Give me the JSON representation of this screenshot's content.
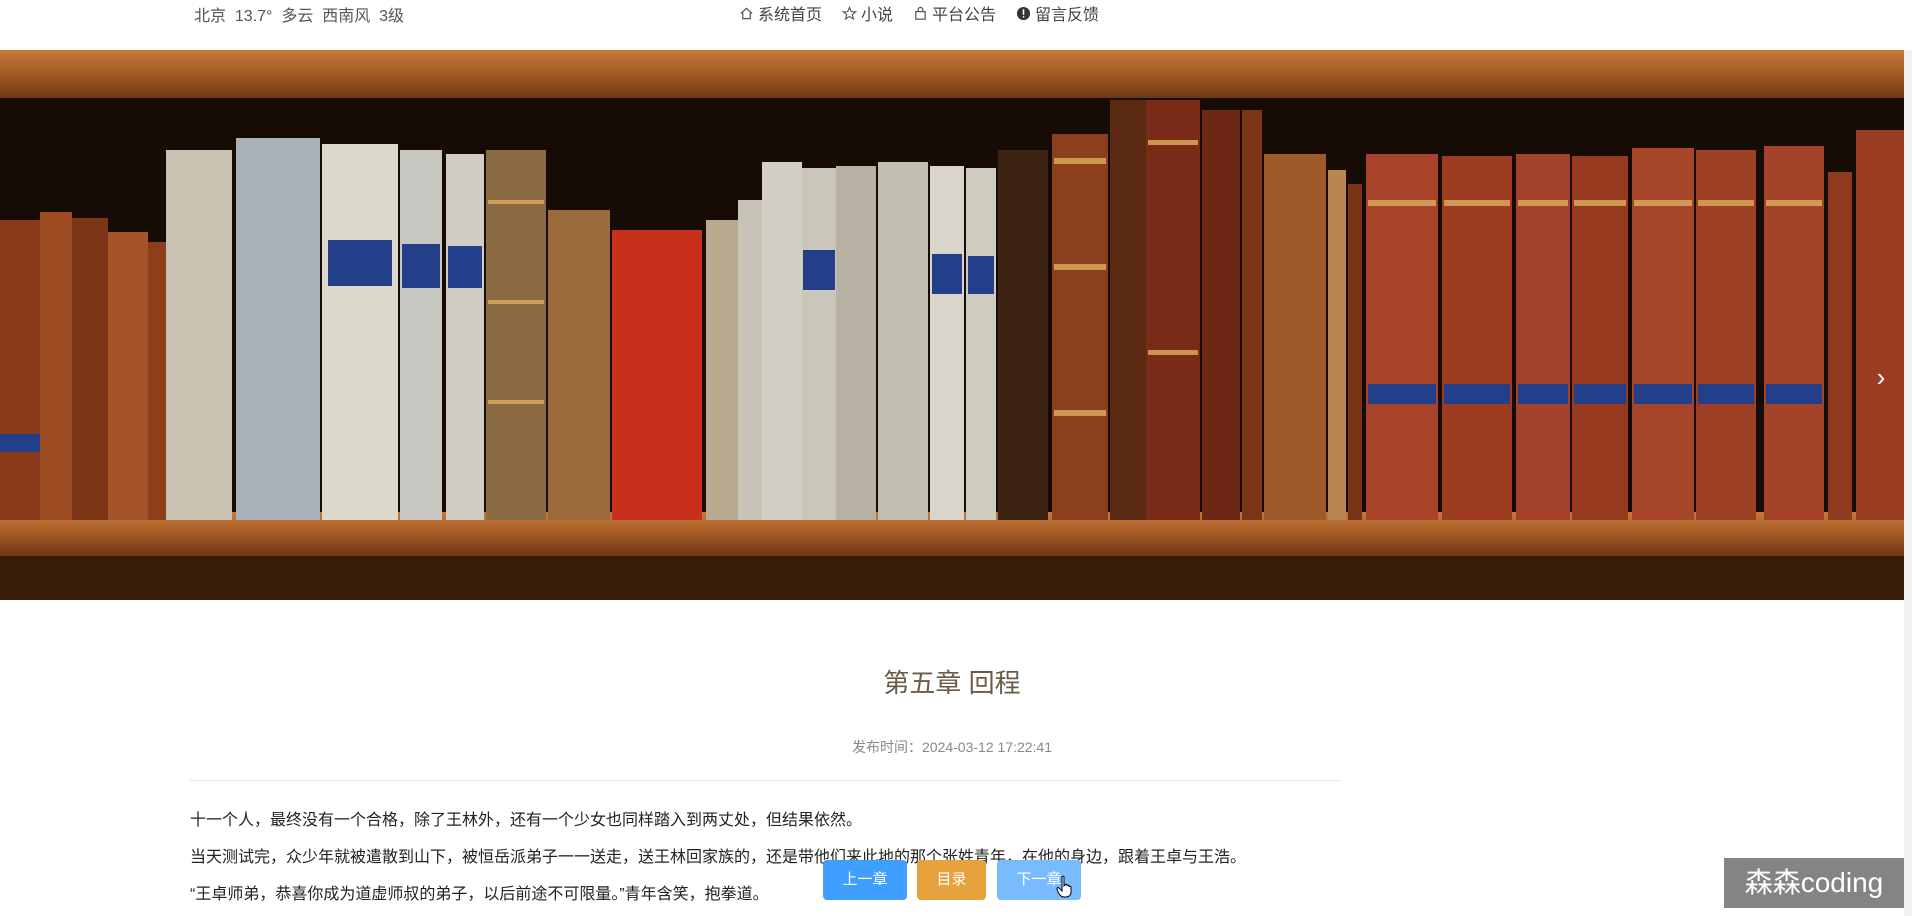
{
  "weather": "北京  13.7°  多云  西南风  3级",
  "nav": {
    "home": "系统首页",
    "novel": "小说",
    "notice": "平台公告",
    "feedback": "留言反馈"
  },
  "chapter": {
    "title": "第五章 回程",
    "publish_time": "发布时间：2024-03-12 17:22:41",
    "paragraphs": [
      "十一个人，最终没有一个合格，除了王林外，还有一个少女也同样踏入到两丈处，但结果依然。",
      "当天测试完，众少年就被遣散到山下，被恒岳派弟子一一送走，送王林回家族的，还是带他们来此地的那个张姓青年，在他的身边，跟着王卓与王浩。",
      "“王卓师弟，恭喜你成为道虚师叔的弟子，以后前途不可限量。”青年含笑，抱拳道。"
    ]
  },
  "buttons": {
    "prev": "上一章",
    "toc": "目录",
    "next": "下一章"
  },
  "watermark": "森森coding",
  "colors": {
    "prev_button": "#409eff",
    "toc_button": "#e6a23c",
    "next_button": "#79bbff",
    "title": "#6b5a47"
  }
}
